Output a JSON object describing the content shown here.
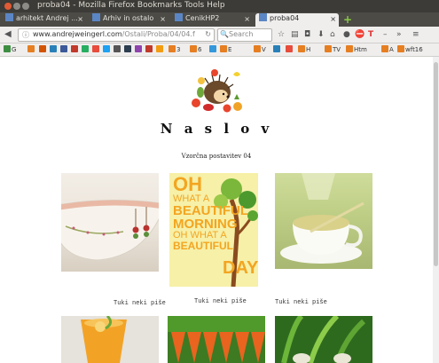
{
  "window": {
    "title": "proba04 - Mozilla Firefox",
    "menu": "Bookmarks  Tools  Help"
  },
  "tabs": [
    {
      "label": "arhitekt Andrej ..."
    },
    {
      "label": "Arhiv in ostalo"
    },
    {
      "label": "CenikHP2"
    },
    {
      "label": "proba04"
    }
  ],
  "nav": {
    "url_domain": "www.andrejweingerl.com",
    "url_path": "/Ostali/Proba/04/04.f",
    "search_placeholder": "Search"
  },
  "bookmarks": [
    {
      "label": "G",
      "color": "#3e8e41"
    },
    {
      "label": "",
      "color": "#e67e22"
    },
    {
      "label": "",
      "color": "#d35400"
    },
    {
      "label": "",
      "color": "#2980b9"
    },
    {
      "label": "",
      "color": "#3b5998"
    },
    {
      "label": "",
      "color": "#c0392b"
    },
    {
      "label": "",
      "color": "#27ae60"
    },
    {
      "label": "",
      "color": "#e74c3c"
    },
    {
      "label": "",
      "color": "#1da1f2"
    },
    {
      "label": "",
      "color": "#555"
    },
    {
      "label": "",
      "color": "#2c3e50"
    },
    {
      "label": "",
      "color": "#8e44ad"
    },
    {
      "label": "",
      "color": "#c0392b"
    },
    {
      "label": "",
      "color": "#f39c12"
    },
    {
      "label": "3",
      "color": "#e67e22"
    },
    {
      "label": "6",
      "color": "#e67e22"
    },
    {
      "label": "",
      "color": "#3498db"
    },
    {
      "label": "E",
      "color": "#e67e22"
    },
    {
      "label": "V",
      "color": "#e67e22"
    },
    {
      "label": "",
      "color": "#2980b9"
    },
    {
      "label": "",
      "color": "#e74c3c"
    },
    {
      "label": "H",
      "color": "#e67e22"
    },
    {
      "label": "TV",
      "color": "#e67e22"
    },
    {
      "label": "Htm",
      "color": "#e67e22"
    },
    {
      "label": "A",
      "color": "#e67e22"
    },
    {
      "label": "wft16",
      "color": "#e67e22"
    }
  ],
  "page": {
    "heading": "N a s l o v",
    "subtitle": "Vzorčna postavitev 04",
    "captions": [
      "Tuki neki piše",
      "Tuki neki piše",
      "Tuki neki piše"
    ],
    "poster_lines": [
      "OH",
      "WHAT A",
      "BEAUTIFUL",
      "MORNING",
      "OH WHAT A",
      "BEAUTIFUL",
      "DAY"
    ]
  }
}
